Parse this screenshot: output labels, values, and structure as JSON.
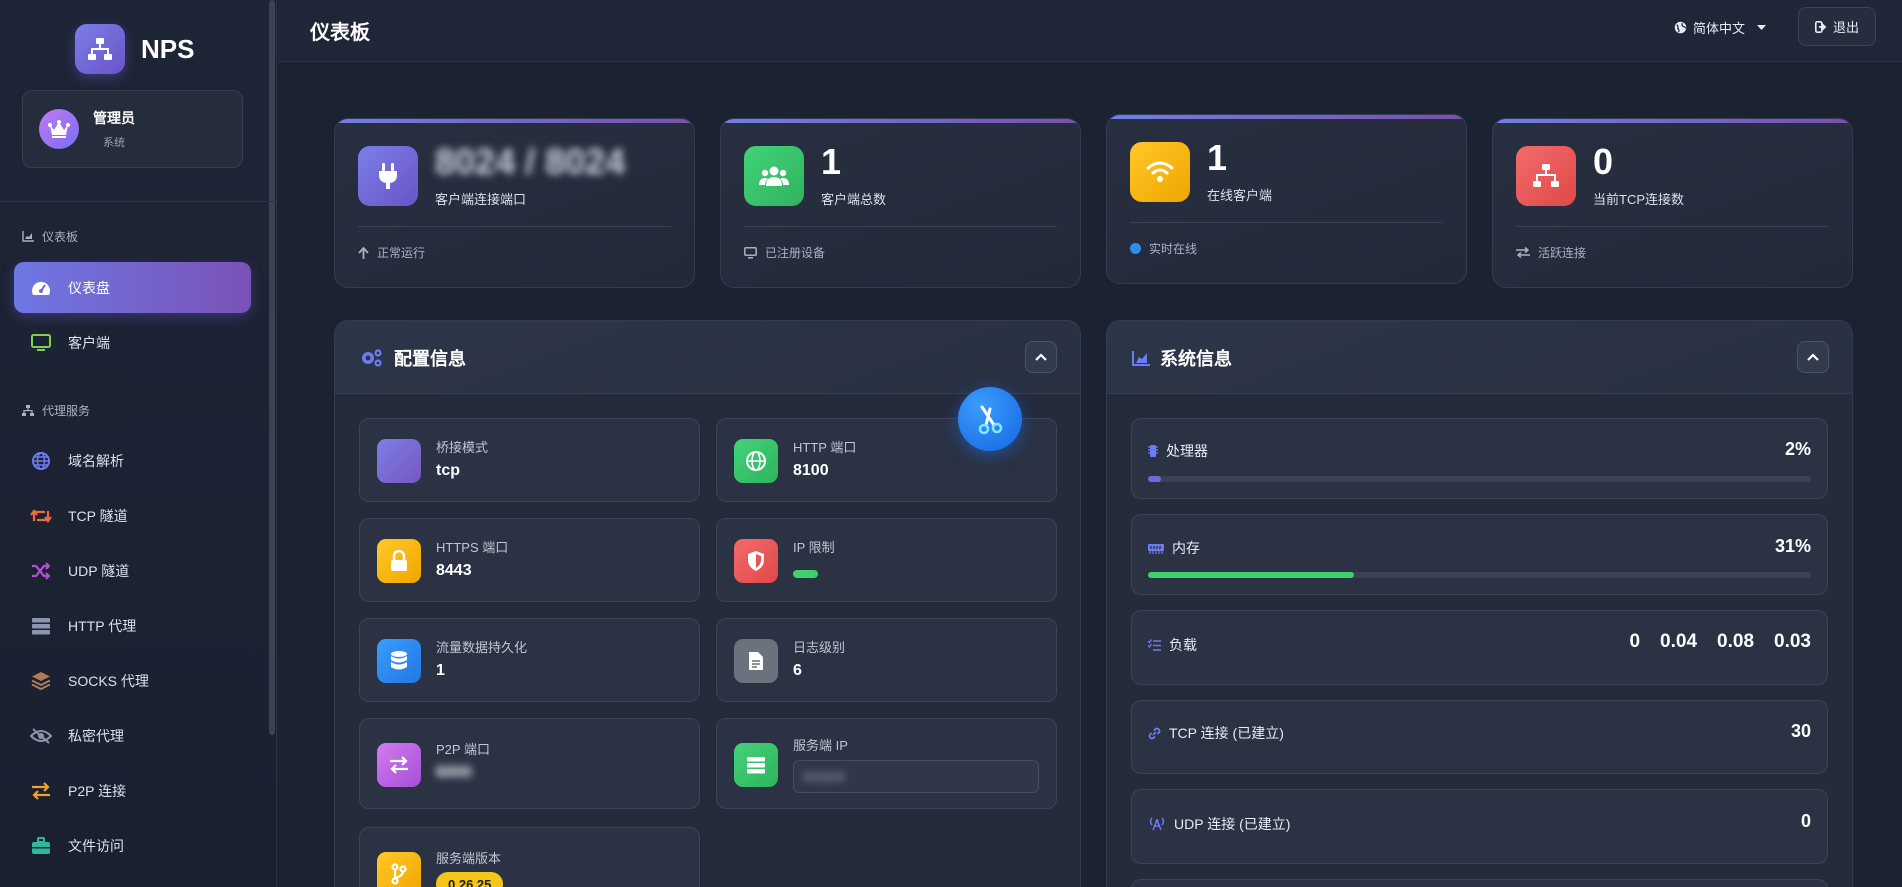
{
  "app": {
    "name": "NPS"
  },
  "user": {
    "name": "管理员",
    "role": "系统"
  },
  "sidebar": {
    "section_dashboard": "仪表板",
    "section_proxy": "代理服务",
    "items": [
      {
        "label": "仪表盘",
        "icon": "dashboard-gauge-icon",
        "active": true
      },
      {
        "label": "客户端",
        "icon": "monitor-icon"
      },
      {
        "label": "域名解析",
        "icon": "globe-icon"
      },
      {
        "label": "TCP 隧道",
        "icon": "retweet-icon"
      },
      {
        "label": "UDP 隧道",
        "icon": "shuffle-icon"
      },
      {
        "label": "HTTP 代理",
        "icon": "server-icon"
      },
      {
        "label": "SOCKS 代理",
        "icon": "layers-icon"
      },
      {
        "label": "私密代理",
        "icon": "eye-slash-icon"
      },
      {
        "label": "P2P 连接",
        "icon": "exchange-icon"
      },
      {
        "label": "文件访问",
        "icon": "briefcase-icon"
      }
    ]
  },
  "header": {
    "title": "仪表板",
    "language": "简体中文",
    "logout": "退出"
  },
  "stats": [
    {
      "value": "8024 / 8024",
      "label": "客户端连接端口",
      "footer": "正常运行",
      "color": "#6f6bd9"
    },
    {
      "value": "1",
      "label": "客户端总数",
      "footer": "已注册设备",
      "color": "#3cc86a"
    },
    {
      "value": "1",
      "label": "在线客户端",
      "footer": "实时在线",
      "color": "#f5b301"
    },
    {
      "value": "0",
      "label": "当前TCP连接数",
      "footer": "活跃连接",
      "color": "#ee5a5a"
    }
  ],
  "config_panel": {
    "title": "配置信息",
    "items": [
      {
        "label": "桥接模式",
        "value": "tcp"
      },
      {
        "label": "HTTP 端口",
        "value": "8100"
      },
      {
        "label": "HTTPS 端口",
        "value": "8443"
      },
      {
        "label": "IP 限制",
        "value": ""
      },
      {
        "label": "流量数据持久化",
        "value": "1"
      },
      {
        "label": "日志级别",
        "value": "6"
      },
      {
        "label": "P2P 端口",
        "value": "6000"
      },
      {
        "label": "服务端 IP",
        "value": "0.0.0.0"
      },
      {
        "label": "服务端版本",
        "value": "0.26.25"
      }
    ]
  },
  "system_panel": {
    "title": "系统信息",
    "cpu": {
      "label": "处理器",
      "value": "2%",
      "percent": 2
    },
    "memory": {
      "label": "内存",
      "value": "31%",
      "percent": 31
    },
    "load": {
      "label": "负载",
      "values": [
        "0",
        "0.04",
        "0.08",
        "0.03"
      ]
    },
    "tcp": {
      "label": "TCP 连接 (已建立)",
      "value": "30"
    },
    "udp": {
      "label": "UDP 连接 (已建立)",
      "value": "0"
    }
  },
  "colors": {
    "accent": "#6f6bd9",
    "success": "#3cc86a",
    "warning": "#f5b301",
    "danger": "#ee5a5a",
    "info": "#2f8fe8"
  }
}
